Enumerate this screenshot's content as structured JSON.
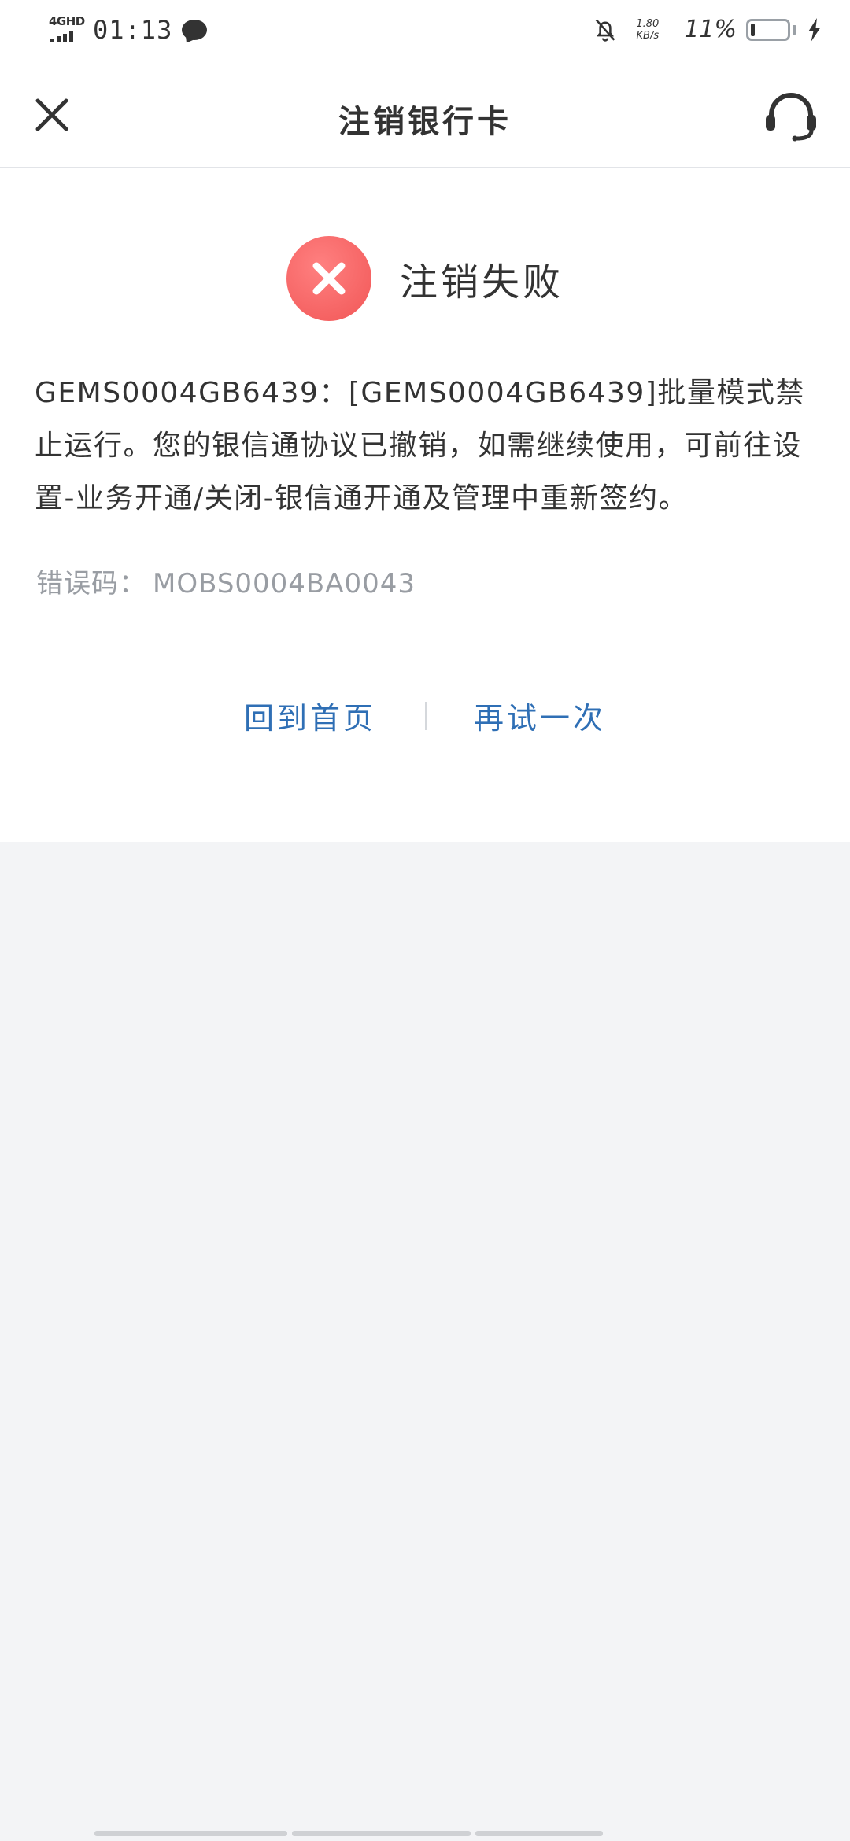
{
  "status_bar": {
    "network": "4GHD",
    "time": "01:13",
    "speed_value": "1.80",
    "speed_unit": "KB/s",
    "battery_percent": "11%",
    "battery_level": 0.11,
    "icons": [
      "signal-icon",
      "message-icon",
      "mute-bell-icon",
      "battery-icon",
      "charging-bolt-icon"
    ]
  },
  "nav": {
    "title": "注销银行卡",
    "left_icon": "close-icon",
    "right_icon": "customer-service-icon"
  },
  "result": {
    "status_icon": "fail-x-icon",
    "title": "注销失败",
    "message": "GEMS0004GB6439：[GEMS0004GB6439]批量模式禁止运行。您的银信通协议已撤销，如需继续使用，可前往设置-业务开通/关闭-银信通开通及管理中重新签约。",
    "error_code_label": "错误码：",
    "error_code": "MOBS0004BA0043"
  },
  "actions": {
    "home_label": "回到首页",
    "retry_label": "再试一次"
  },
  "colors": {
    "accent_link": "#2f6fb5",
    "fail_red": "#f15656",
    "background_gray": "#f3f4f6"
  }
}
